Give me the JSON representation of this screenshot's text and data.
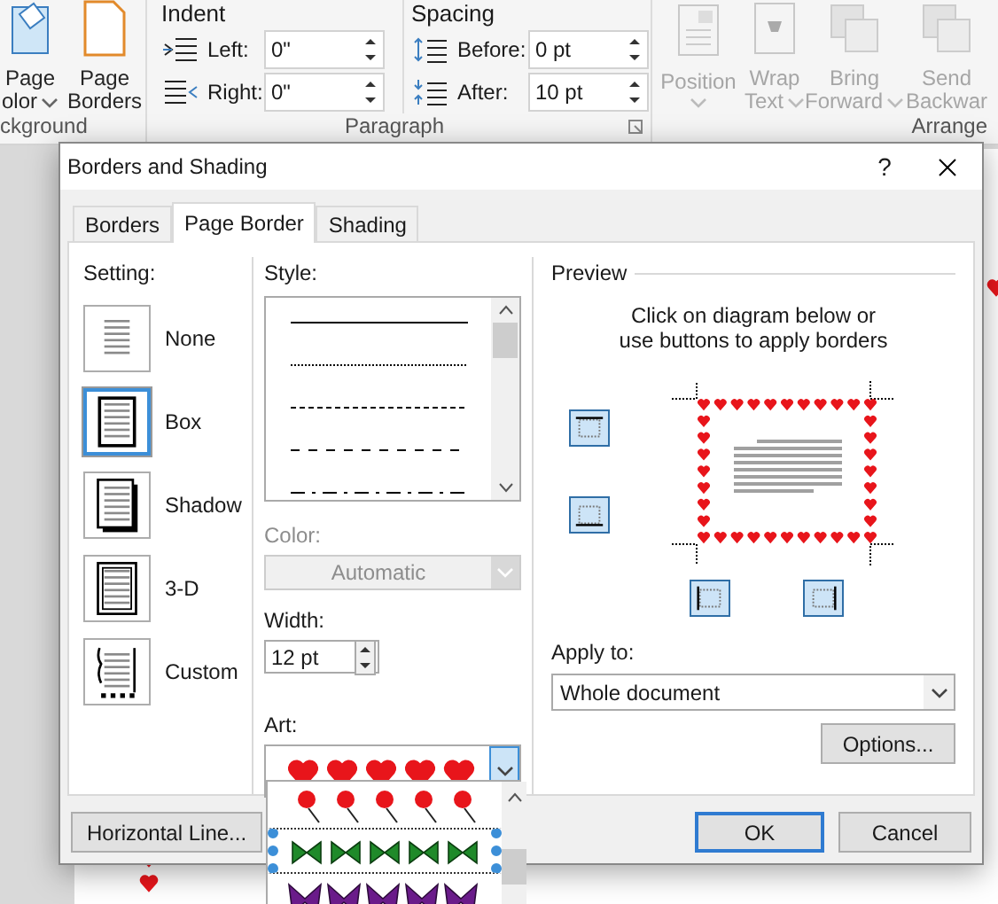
{
  "ribbon": {
    "background_group": {
      "label": "ckground",
      "buttons": [
        {
          "kind": "page_color",
          "lines": [
            "Page",
            "olor"
          ],
          "dropdown": true
        },
        {
          "kind": "page_borders",
          "lines": [
            "Page",
            "Borders"
          ],
          "dropdown": false
        }
      ]
    },
    "paragraph_group": {
      "label": "Paragraph",
      "indent": {
        "title": "Indent",
        "rows": [
          {
            "kind": "left",
            "label": "Left:",
            "value": "0\""
          },
          {
            "kind": "right",
            "label": "Right:",
            "value": "0\""
          }
        ]
      },
      "spacing": {
        "title": "Spacing",
        "rows": [
          {
            "kind": "before",
            "label": "Before:",
            "value": "0 pt"
          },
          {
            "kind": "after",
            "label": "After:",
            "value": "10 pt"
          }
        ]
      }
    },
    "arrange_group": {
      "label": "Arrange",
      "buttons": [
        {
          "kind": "position",
          "lines": [
            "Position"
          ],
          "dropdown": true,
          "disabled": true
        },
        {
          "kind": "wrap",
          "lines": [
            "Wrap",
            "Text"
          ],
          "dropdown": true,
          "disabled": true
        },
        {
          "kind": "bring",
          "lines": [
            "Bring",
            "Forward"
          ],
          "dropdown": true,
          "disabled": true
        },
        {
          "kind": "send",
          "lines": [
            "Send",
            "Backwar"
          ],
          "dropdown": false,
          "disabled": true
        }
      ]
    }
  },
  "dialog": {
    "title": "Borders and Shading",
    "help": "?",
    "tabs": [
      {
        "label": "Borders",
        "selected": false
      },
      {
        "label": "Page Border",
        "selected": true
      },
      {
        "label": "Shading",
        "selected": false
      }
    ],
    "setting": {
      "label": "Setting:",
      "items": [
        {
          "kind": "none",
          "label": "None",
          "selected": false
        },
        {
          "kind": "box",
          "label": "Box",
          "selected": true
        },
        {
          "kind": "shadow",
          "label": "Shadow",
          "selected": false
        },
        {
          "kind": "three_d",
          "label": "3-D",
          "selected": false
        },
        {
          "kind": "custom",
          "label": "Custom",
          "selected": false
        }
      ]
    },
    "style": {
      "label": "Style:",
      "items": [
        {
          "kind": "solid"
        },
        {
          "kind": "dotted"
        },
        {
          "kind": "dashed"
        },
        {
          "kind": "wide_dashed"
        },
        {
          "kind": "dash_dot"
        }
      ]
    },
    "color": {
      "label": "Color:",
      "value": "Automatic",
      "disabled": true
    },
    "width": {
      "label": "Width:",
      "value": "12 pt"
    },
    "art": {
      "label": "Art:",
      "value": {
        "kind": "hearts"
      },
      "open": true,
      "options": [
        {
          "kind": "balloons",
          "selected": false
        },
        {
          "kind": "bows",
          "selected": true
        },
        {
          "kind": "butterflies",
          "selected": false
        }
      ]
    },
    "preview": {
      "label": "Preview",
      "instructions": "Click on diagram below or use buttons to apply borders",
      "border": {
        "kind": "hearts"
      }
    },
    "apply_to": {
      "label": "Apply to:",
      "value": "Whole document"
    },
    "options_button": "Options...",
    "horizontal_line_button": "Horizontal Line...",
    "ok_button": "OK",
    "cancel_button": "Cancel"
  }
}
